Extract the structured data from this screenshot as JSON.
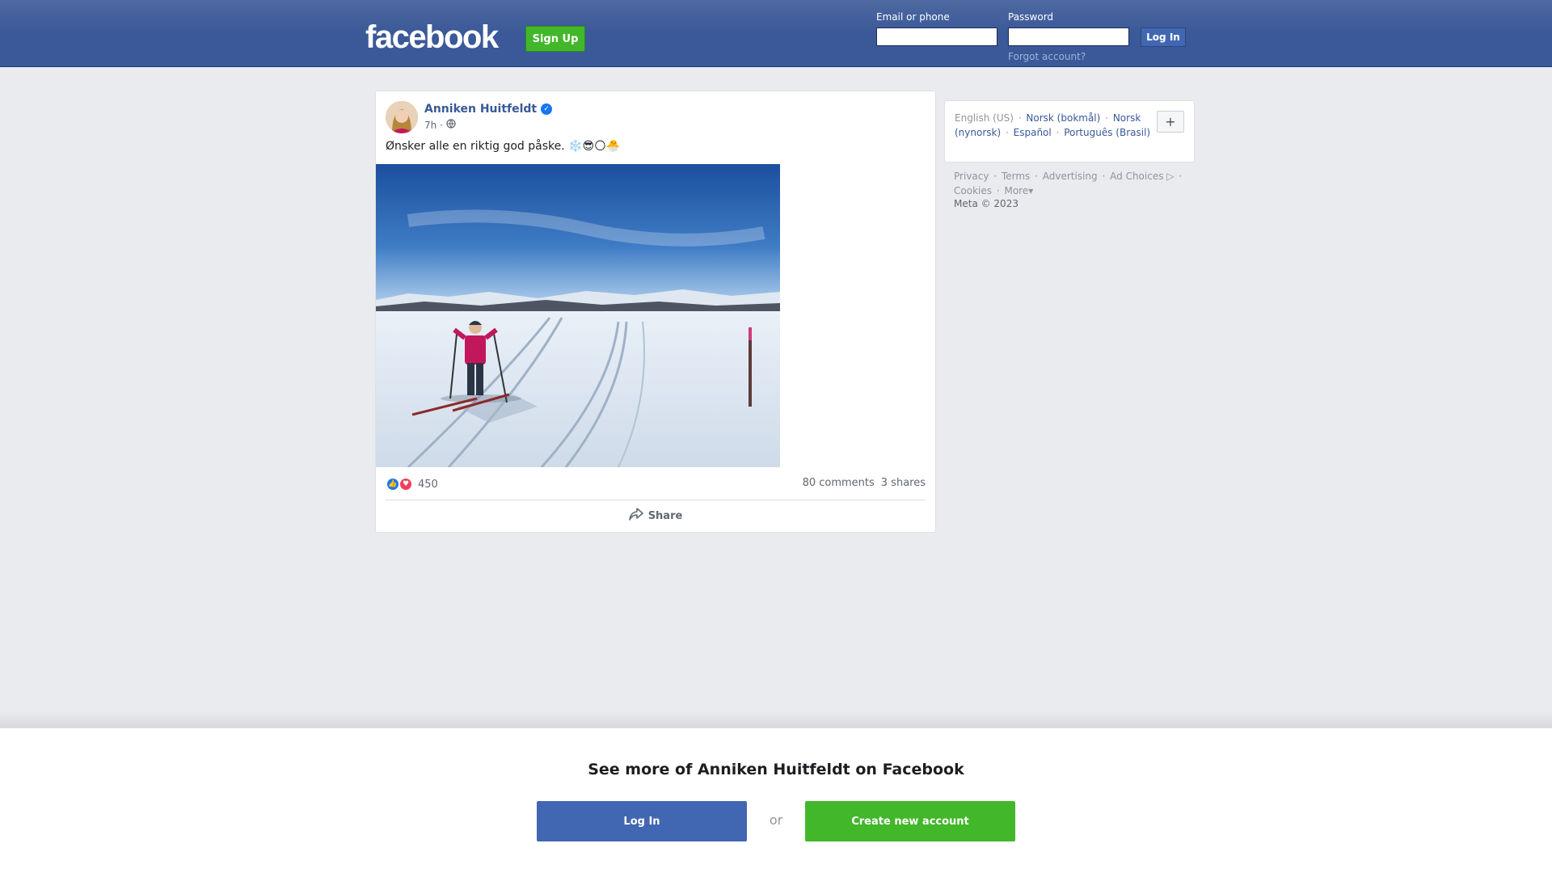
{
  "header": {
    "logo_text": "facebook",
    "signup_label": "Sign Up",
    "email_label": "Email or phone",
    "email_value": "",
    "password_label": "Password",
    "password_value": "",
    "login_label": "Log In",
    "forgot_label": "Forgot account?"
  },
  "post": {
    "author": "Anniken Huitfeldt",
    "verified": true,
    "time": "7h",
    "separator": "·",
    "audience_icon": "globe-icon",
    "text": "Ønsker alle en riktig god påske. ❄️😎🌕🐣",
    "reaction_icons": [
      "like-icon",
      "love-icon"
    ],
    "reaction_count": "450",
    "comments": "80 comments",
    "shares": "3 shares",
    "share_label": "Share"
  },
  "sidebar": {
    "current_language": "English (US)",
    "languages": [
      "Norsk (bokmål)",
      "Norsk (nynorsk)",
      "Español",
      "Português (Brasil)"
    ],
    "separator": "·",
    "more_languages_icon": "plus-icon",
    "footer_links": [
      "Privacy",
      "Terms",
      "Advertising",
      "Ad Choices",
      "Cookies",
      "More"
    ],
    "copyright": "Meta © 2023"
  },
  "bottom": {
    "title": "See more of Anniken Huitfeldt on Facebook",
    "login_label": "Log In",
    "or_label": "or",
    "create_label": "Create new account"
  },
  "colors": {
    "brand_blue": "#3b5998",
    "button_blue": "#4267b2",
    "green": "#42b72a",
    "page_bg": "#e9ebee"
  }
}
